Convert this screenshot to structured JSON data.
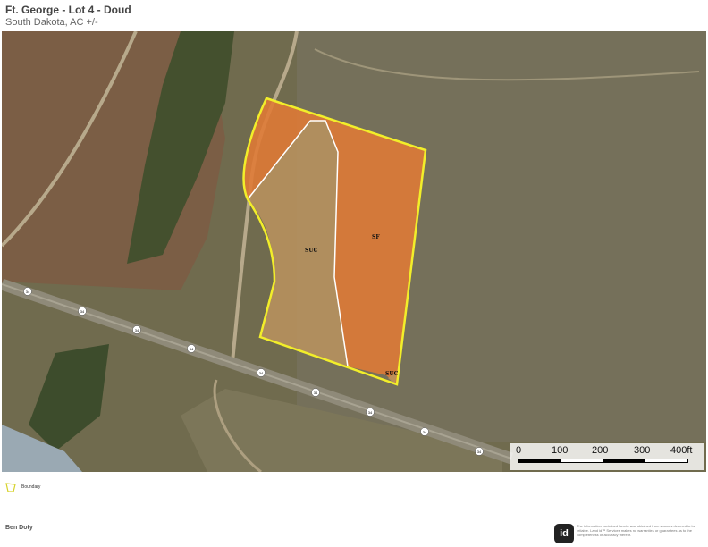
{
  "header": {
    "title": "Ft. George - Lot 4 - Doud",
    "subtitle": "South Dakota,  AC +/-"
  },
  "map": {
    "parcel_labels": [
      "SUC",
      "SF",
      "SUC"
    ],
    "road_shield": "34",
    "colors": {
      "boundary": "#f2ee2a",
      "sf_fill": "#e07a35",
      "suc_fill": "#b8925f",
      "water": "#9aa9b3"
    }
  },
  "scale": {
    "ticks": [
      "0",
      "100",
      "200",
      "300",
      "400ft"
    ]
  },
  "legend": {
    "label": "Boundary",
    "icon": "boundary-polygon-icon"
  },
  "footer": {
    "author": "Ben Doty",
    "logo_text": "id",
    "disclaimer": "The information contained herein was obtained from sources deemed to be reliable. Land id™ Services makes no warranties or guarantees as to the completeness or accuracy thereof."
  }
}
